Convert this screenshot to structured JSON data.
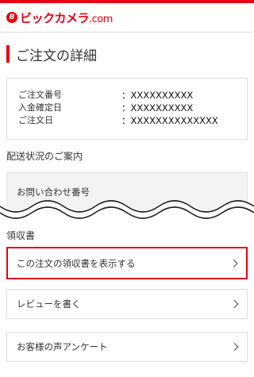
{
  "header": {
    "logo_mark": "B",
    "logo_text": "ビックカメラ",
    "logo_domain": ".com"
  },
  "page": {
    "title": "ご注文の詳細"
  },
  "order": {
    "rows": [
      {
        "label": "ご注文番号",
        "value": "：XXXXXXXXXX"
      },
      {
        "label": "入金確定日",
        "value": "：XXXXXXXXXX"
      },
      {
        "label": "ご注文日",
        "value": "：XXXXXXXXXXXXXX"
      }
    ]
  },
  "shipping": {
    "section_label": "配送状況のご案内",
    "inquiry_label": "お問い合わせ番号"
  },
  "receipt": {
    "section_label": "領収書",
    "show_receipt_label": "この注文の領収書を表示する"
  },
  "links": {
    "review_label": "レビューを書く",
    "survey_label": "お客様の声アンケート"
  },
  "colors": {
    "brand": "#e60012",
    "border": "#dddddd",
    "panel": "#f3f3f3"
  }
}
